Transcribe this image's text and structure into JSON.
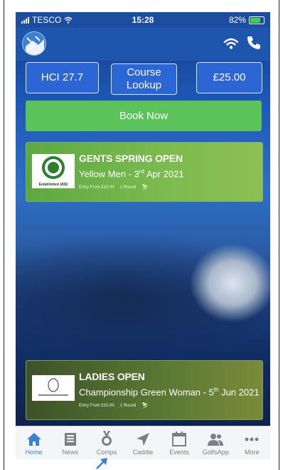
{
  "status_bar": {
    "carrier": "TESCO",
    "time": "15:28",
    "battery": "82%"
  },
  "header": {
    "logo": "golf-ball-logo",
    "icons": [
      "wifi-icon",
      "phone-icon"
    ]
  },
  "buttons": {
    "handicap": "HCI 27.7",
    "course_lookup": "Course Lookup",
    "price": "£25.00",
    "book_now": "Book Now"
  },
  "competitions": [
    {
      "title": "GENTS SPRING OPEN",
      "subtitle_prefix": "Yellow Men - 3",
      "subtitle_sup": "rd",
      "subtitle_suffix": " Apr 2021",
      "entry": "Entry From £10.00",
      "rounds": "1 Round",
      "crest_text": "Established 1892"
    },
    {
      "title": "LADIES OPEN",
      "subtitle_prefix": "Championship Green Woman - 5",
      "subtitle_sup": "th",
      "subtitle_suffix": " Jun 2021",
      "entry": "Entry From £15.00",
      "rounds": "1 Round",
      "crest_text": ""
    }
  ],
  "tabs": [
    {
      "label": "Home",
      "icon": "home-icon",
      "active": true
    },
    {
      "label": "News",
      "icon": "news-icon",
      "active": false
    },
    {
      "label": "Comps",
      "icon": "medal-icon",
      "active": false
    },
    {
      "label": "Caddie",
      "icon": "navigation-arrow-icon",
      "active": false
    },
    {
      "label": "Events",
      "icon": "calendar-icon",
      "active": false
    },
    {
      "label": "GolfsApp",
      "icon": "people-icon",
      "active": false
    },
    {
      "label": "More",
      "icon": "more-dots-icon",
      "active": false
    }
  ],
  "colors": {
    "accent_blue": "#2b66d4",
    "book_green": "#5cc25a",
    "tab_active": "#3d7fd6"
  }
}
